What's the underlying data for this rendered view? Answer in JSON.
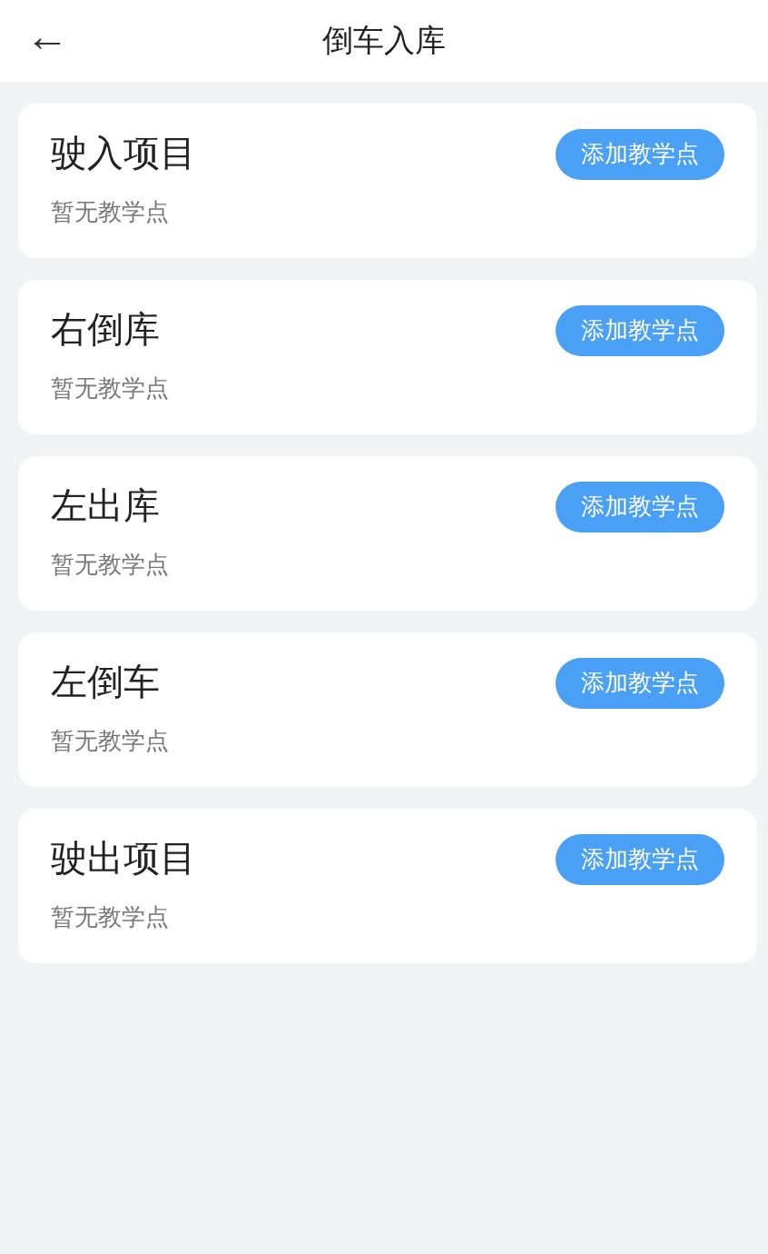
{
  "header": {
    "back_icon": "←",
    "title": "倒车入库"
  },
  "items": [
    {
      "title": "驶入项目",
      "subtitle": "暂无教学点",
      "button": "添加教学点"
    },
    {
      "title": "右倒库",
      "subtitle": "暂无教学点",
      "button": "添加教学点"
    },
    {
      "title": "左出库",
      "subtitle": "暂无教学点",
      "button": "添加教学点"
    },
    {
      "title": "左倒车",
      "subtitle": "暂无教学点",
      "button": "添加教学点"
    },
    {
      "title": "驶出项目",
      "subtitle": "暂无教学点",
      "button": "添加教学点"
    }
  ]
}
